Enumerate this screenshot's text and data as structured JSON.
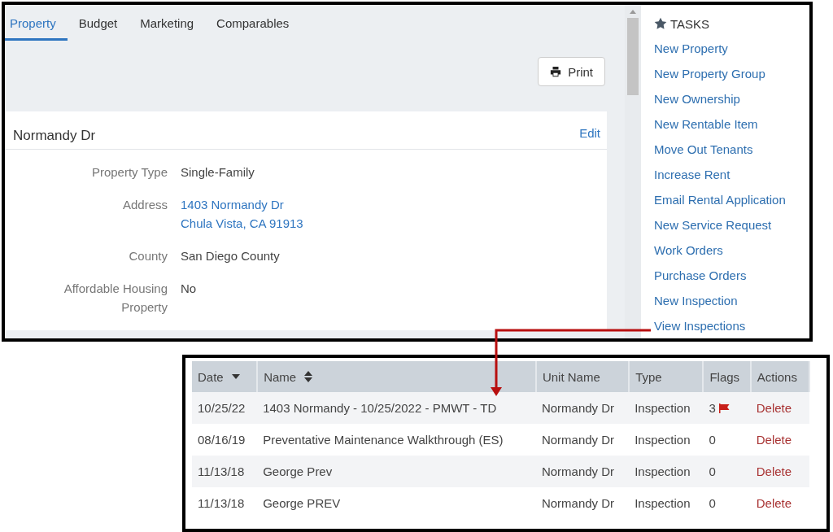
{
  "tabs": [
    {
      "label": "Property",
      "selected": true
    },
    {
      "label": "Budget",
      "selected": false
    },
    {
      "label": "Marketing",
      "selected": false
    },
    {
      "label": "Comparables",
      "selected": false
    }
  ],
  "print_button": "Print",
  "property_card": {
    "title": "Normandy Dr",
    "edit": "Edit",
    "fields": [
      {
        "label": "Property Type",
        "values": [
          "Single-Family"
        ],
        "kind": "text"
      },
      {
        "label": "Address",
        "values": [
          "1403 Normandy Dr",
          "Chula Vista, CA 91913"
        ],
        "kind": "link"
      },
      {
        "label": "County",
        "values": [
          "San Diego County"
        ],
        "kind": "text"
      },
      {
        "label": "Affordable Housing Property",
        "values": [
          "No"
        ],
        "kind": "text"
      }
    ]
  },
  "tasks": {
    "title": "TASKS",
    "items": [
      "New Property",
      "New Property Group",
      "New Ownership",
      "New Rentable Item",
      "Move Out Tenants",
      "Increase Rent",
      "Email Rental Application",
      "New Service Request",
      "Work Orders",
      "Purchase Orders",
      "New Inspection",
      "View Inspections"
    ]
  },
  "inspections_table": {
    "columns": [
      {
        "label": "Date",
        "kind": "sortdown"
      },
      {
        "label": "Name",
        "kind": "sortable"
      },
      {
        "label": "Unit Name",
        "kind": "plain"
      },
      {
        "label": "Type",
        "kind": "plain"
      },
      {
        "label": "Flags",
        "kind": "plain"
      },
      {
        "label": "Actions",
        "kind": "plain"
      }
    ],
    "rows": [
      {
        "date": "10/25/22",
        "name": "1403 Normandy - 10/25/2022 - PMWT - TD",
        "unit": "Normandy Dr",
        "type": "Inspection",
        "flags": "3",
        "flagged": true,
        "action": "Delete"
      },
      {
        "date": "08/16/19",
        "name": "Preventative Maintenance Walkthrough (ES)",
        "unit": "Normandy Dr",
        "type": "Inspection",
        "flags": "0",
        "flagged": false,
        "action": "Delete"
      },
      {
        "date": "11/13/18",
        "name": "George Prev",
        "unit": "Normandy Dr",
        "type": "Inspection",
        "flags": "0",
        "flagged": false,
        "action": "Delete"
      },
      {
        "date": "11/13/18",
        "name": "George PREV",
        "unit": "Normandy Dr",
        "type": "Inspection",
        "flags": "0",
        "flagged": false,
        "action": "Delete"
      }
    ]
  }
}
